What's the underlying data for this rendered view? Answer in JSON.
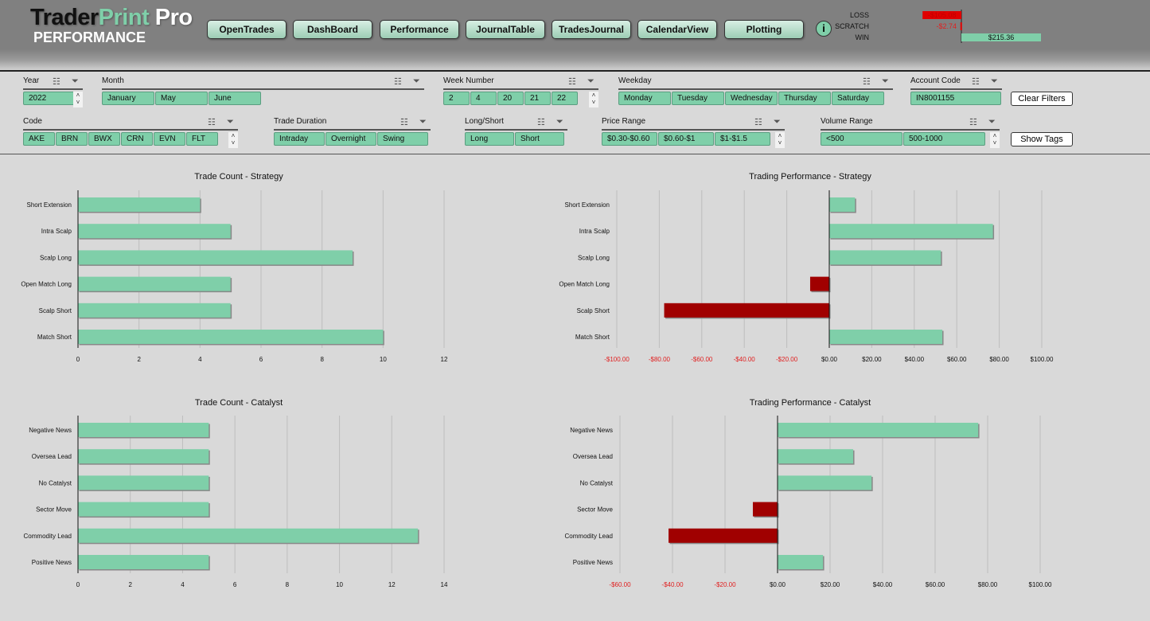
{
  "header": {
    "logo": {
      "a": "Trader",
      "b": "Print",
      "c": " Pro"
    },
    "subtitle": "PERFORMANCE",
    "nav": [
      "OpenTrades",
      "DashBoard",
      "Performance",
      "JournalTable",
      "TradesJournal",
      "CalendarView",
      "Plotting"
    ],
    "info": "i"
  },
  "summary": {
    "rows": [
      {
        "label": "LOSS",
        "value": -105.08,
        "text": "-$105.08",
        "color": "#e00000"
      },
      {
        "label": "SCRATCH",
        "value": -2.74,
        "text": "-$2.74",
        "color": "#e00000"
      },
      {
        "label": "WIN",
        "value": 215.36,
        "text": "$215.36",
        "color": "#7fcfa9"
      }
    ]
  },
  "slicers": [
    {
      "title": "Year",
      "items": [
        "2022"
      ]
    },
    {
      "title": "Month",
      "items": [
        "January",
        "May",
        "June"
      ]
    },
    {
      "title": "Week Number",
      "items": [
        "2",
        "4",
        "20",
        "21",
        "22"
      ]
    },
    {
      "title": "Weekday",
      "items": [
        "Monday",
        "Tuesday",
        "Wednesday",
        "Thursday",
        "Saturday"
      ]
    },
    {
      "title": "Account Code",
      "items": [
        "IN8001155"
      ]
    },
    {
      "title": "Code",
      "items": [
        "AKE",
        "BRN",
        "BWX",
        "CRN",
        "EVN",
        "FLT"
      ]
    },
    {
      "title": "Trade Duration",
      "items": [
        "Intraday",
        "Overnight",
        "Swing"
      ]
    },
    {
      "title": "Long/Short",
      "items": [
        "Long",
        "Short"
      ]
    },
    {
      "title": "Price Range",
      "items": [
        "$0.30-$0.60",
        "$0.60-$1",
        "$1-$1.5"
      ]
    },
    {
      "title": "Volume Range",
      "items": [
        "<500",
        "500-1000"
      ]
    }
  ],
  "buttons": {
    "clear": "Clear Filters",
    "tags": "Show Tags"
  },
  "colors": {
    "positive": "#7fcfa9",
    "negative": "#a00000",
    "negative_label": "#e02020"
  },
  "chart_data": [
    {
      "type": "bar",
      "orientation": "horizontal",
      "title": "Trade Count - Strategy",
      "categories": [
        "Short Extension",
        "Intra Scalp",
        "Scalp Long",
        "Open Match Long",
        "Scalp Short",
        "Match Short"
      ],
      "values": [
        4,
        5,
        9,
        5,
        5,
        10
      ],
      "xlim": [
        0,
        12
      ],
      "ticks": [
        "0",
        "2",
        "4",
        "6",
        "8",
        "10",
        "12"
      ],
      "grid": true
    },
    {
      "type": "bar",
      "orientation": "horizontal",
      "title": "Trading Performance - Strategy",
      "categories": [
        "Short Extension",
        "Intra Scalp",
        "Scalp Long",
        "Open Match Long",
        "Scalp Short",
        "Match Short"
      ],
      "values": [
        12.1,
        77.0,
        52.5,
        -9.0,
        -77.7,
        53.2
      ],
      "xlim": [
        -100,
        100
      ],
      "ticks": [
        "-$100.00",
        "-$80.00",
        "-$60.00",
        "-$40.00",
        "-$20.00",
        "$0.00",
        "$20.00",
        "$40.00",
        "$60.00",
        "$80.00",
        "$100.00"
      ],
      "grid": true
    },
    {
      "type": "bar",
      "orientation": "horizontal",
      "title": "Trade Count - Catalyst",
      "categories": [
        "Negative News",
        "Oversea Lead",
        "No Catalyst",
        "Sector Move",
        "Commodity Lead",
        "Positive News"
      ],
      "values": [
        5,
        5,
        5,
        5,
        13,
        5
      ],
      "xlim": [
        0,
        14
      ],
      "ticks": [
        "0",
        "2",
        "4",
        "6",
        "8",
        "10",
        "12",
        "14"
      ],
      "grid": true
    },
    {
      "type": "bar",
      "orientation": "horizontal",
      "title": "Trading Performance - Catalyst",
      "categories": [
        "Negative News",
        "Oversea Lead",
        "No Catalyst",
        "Sector Move",
        "Commodity Lead",
        "Positive News"
      ],
      "values": [
        76.4,
        28.8,
        35.8,
        -9.4,
        -41.5,
        17.3
      ],
      "xlim": [
        -60,
        100
      ],
      "ticks": [
        "-$60.00",
        "-$40.00",
        "-$20.00",
        "$0.00",
        "$20.00",
        "$40.00",
        "$60.00",
        "$80.00",
        "$100.00"
      ],
      "grid": true
    }
  ]
}
